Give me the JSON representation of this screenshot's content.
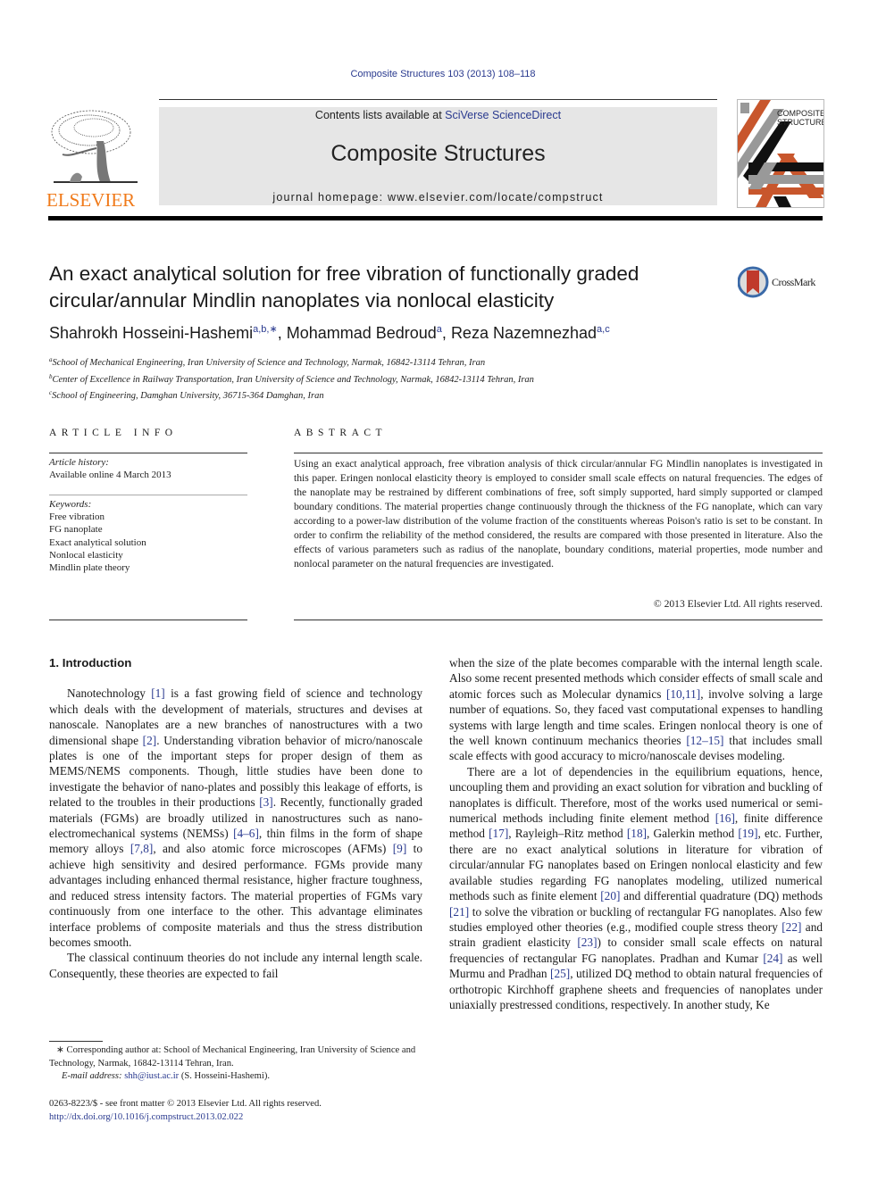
{
  "header": {
    "journal_ref": "Composite Structures 103 (2013) 108–118",
    "contents_prefix": "Contents lists available at ",
    "contents_link": "SciVerse ScienceDirect",
    "journal_title": "Composite Structures",
    "homepage": "journal homepage: www.elsevier.com/locate/compstruct",
    "publisher_logo_text": "ELSEVIER",
    "cover_text_line1": "COMPOSITE",
    "cover_text_line2": "STRUCTURES",
    "crossmark_label": "CrossMark",
    "colors": {
      "elsevier_orange": "#f07a1a",
      "link_blue": "#2a3a8f",
      "banner_gray": "#e6e6e6",
      "cover_orange": "#c8562c"
    }
  },
  "article": {
    "title_line1": "An exact analytical solution for free vibration of functionally graded",
    "title_line2": "circular/annular Mindlin nanoplates via nonlocal elasticity",
    "authors": [
      {
        "name": "Shahrokh Hosseini-Hashemi",
        "sup": "a,b,∗",
        "sep": ", "
      },
      {
        "name": "Mohammad Bedroud",
        "sup": "a",
        "sep": ", "
      },
      {
        "name": "Reza Nazemnezhad",
        "sup": "a,c",
        "sep": ""
      }
    ],
    "affiliations": [
      {
        "mark": "a",
        "text": "School of Mechanical Engineering, Iran University of Science and Technology, Narmak, 16842-13114 Tehran, Iran"
      },
      {
        "mark": "b",
        "text": "Center of Excellence in Railway Transportation, Iran University of Science and Technology, Narmak, 16842-13114 Tehran, Iran"
      },
      {
        "mark": "c",
        "text": "School of Engineering, Damghan University, 36715-364 Damghan, Iran"
      }
    ]
  },
  "article_info": {
    "heading": "ARTICLE INFO",
    "history_label": "Article history:",
    "history_value": "Available online 4 March 2013",
    "keywords_label": "Keywords:",
    "keywords": [
      "Free vibration",
      "FG nanoplate",
      "Exact analytical solution",
      "Nonlocal elasticity",
      "Mindlin plate theory"
    ]
  },
  "abstract": {
    "heading": "ABSTRACT",
    "text": "Using an exact analytical approach, free vibration analysis of thick circular/annular FG Mindlin nanoplates is investigated in this paper. Eringen nonlocal elasticity theory is employed to consider small scale effects on natural frequencies. The edges of the nanoplate may be restrained by different combinations of free, soft simply supported, hard simply supported or clamped boundary conditions. The material properties change continuously through the thickness of the FG nanoplate, which can vary according to a power-law distribution of the volume fraction of the constituents whereas Poison's ratio is set to be constant. In order to confirm the reliability of the method considered, the results are compared with those presented in literature. Also the effects of various parameters such as radius of the nanoplate, boundary conditions, material properties, mode number and nonlocal parameter on the natural frequencies are investigated.",
    "copyright": "© 2013 Elsevier Ltd. All rights reserved."
  },
  "body": {
    "section_heading": "1. Introduction",
    "left_p1": [
      {
        "t": "Nanotechnology "
      },
      {
        "r": "[1]"
      },
      {
        "t": " is a fast growing field of science and technology which deals with the development of materials, structures and devises at nanoscale. Nanoplates are a new branches of nanostructures with a two dimensional shape "
      },
      {
        "r": "[2]"
      },
      {
        "t": ". Understanding vibration behavior of micro/nanoscale plates is one of the important steps for proper design of them as MEMS/NEMS components. Though, little studies have been done to investigate the behavior of nano-plates and possibly this leakage of efforts, is related to the troubles in their productions "
      },
      {
        "r": "[3]"
      },
      {
        "t": ". Recently, functionally graded materials (FGMs) are broadly utilized in nanostructures such as nano-electromechanical systems (NEMSs) "
      },
      {
        "r": "[4–6]"
      },
      {
        "t": ", thin films in the form of shape memory alloys "
      },
      {
        "r": "[7,8]"
      },
      {
        "t": ", and also atomic force microscopes (AFMs) "
      },
      {
        "r": "[9]"
      },
      {
        "t": " to achieve high sensitivity and desired performance. FGMs provide many advantages including enhanced thermal resistance, higher fracture toughness, and reduced stress intensity factors. The material properties of FGMs vary continuously from one interface to the other. This advantage eliminates interface problems of composite materials and thus the stress distribution becomes smooth."
      }
    ],
    "left_p2": [
      {
        "t": "The classical continuum theories do not include any internal length scale. Consequently, these theories are expected to fail"
      }
    ],
    "right_p1": [
      {
        "t": "when the size of the plate becomes comparable with the internal length scale. Also some recent presented methods which consider effects of small scale and atomic forces such as Molecular dynamics "
      },
      {
        "r": "[10,11]"
      },
      {
        "t": ", involve solving a large number of equations. So, they faced vast computational expenses to handling systems with large length and time scales. Eringen nonlocal theory is one of the well known continuum mechanics theories "
      },
      {
        "r": "[12–15]"
      },
      {
        "t": " that includes small scale effects with good accuracy to micro/nanoscale devises modeling."
      }
    ],
    "right_p2": [
      {
        "t": "There are a lot of dependencies in the equilibrium equations, hence, uncoupling them and providing an exact solution for vibration and buckling of nanoplates is difficult. Therefore, most of the works used numerical or semi-numerical methods including finite element method "
      },
      {
        "r": "[16]"
      },
      {
        "t": ", finite difference method "
      },
      {
        "r": "[17]"
      },
      {
        "t": ", Rayleigh–Ritz method "
      },
      {
        "r": "[18]"
      },
      {
        "t": ", Galerkin method "
      },
      {
        "r": "[19]"
      },
      {
        "t": ", etc. Further, there are no exact analytical solutions in literature for vibration of circular/annular FG nanoplates based on Eringen nonlocal elasticity and few available studies regarding FG nanoplates modeling, utilized numerical methods such as finite element "
      },
      {
        "r": "[20]"
      },
      {
        "t": " and differential quadrature (DQ) methods "
      },
      {
        "r": "[21]"
      },
      {
        "t": " to solve the vibration or buckling of rectangular FG nanoplates. Also few studies employed other theories (e.g., modified couple stress theory "
      },
      {
        "r": "[22]"
      },
      {
        "t": " and strain gradient elasticity "
      },
      {
        "r": "[23]"
      },
      {
        "t": ") to consider small scale effects on natural frequencies of rectangular FG nanoplates. Pradhan and Kumar "
      },
      {
        "r": "[24]"
      },
      {
        "t": " as well Murmu and Pradhan "
      },
      {
        "r": "[25]"
      },
      {
        "t": ", utilized DQ method to obtain natural frequencies of orthotropic Kirchhoff graphene sheets and frequencies of nanoplates under uniaxially prestressed conditions, respectively. In another study, Ke"
      }
    ]
  },
  "footnotes": {
    "corresponding": "∗ Corresponding author at: School of Mechanical Engineering, Iran University of Science and Technology, Narmak, 16842-13114 Tehran, Iran.",
    "email_label": "E-mail address: ",
    "email": "shh@iust.ac.ir",
    "email_owner": " (S. Hosseini-Hashemi).",
    "issn": "0263-8223/$ - see front matter © 2013 Elsevier Ltd. All rights reserved.",
    "doi": "http://dx.doi.org/10.1016/j.compstruct.2013.02.022"
  }
}
